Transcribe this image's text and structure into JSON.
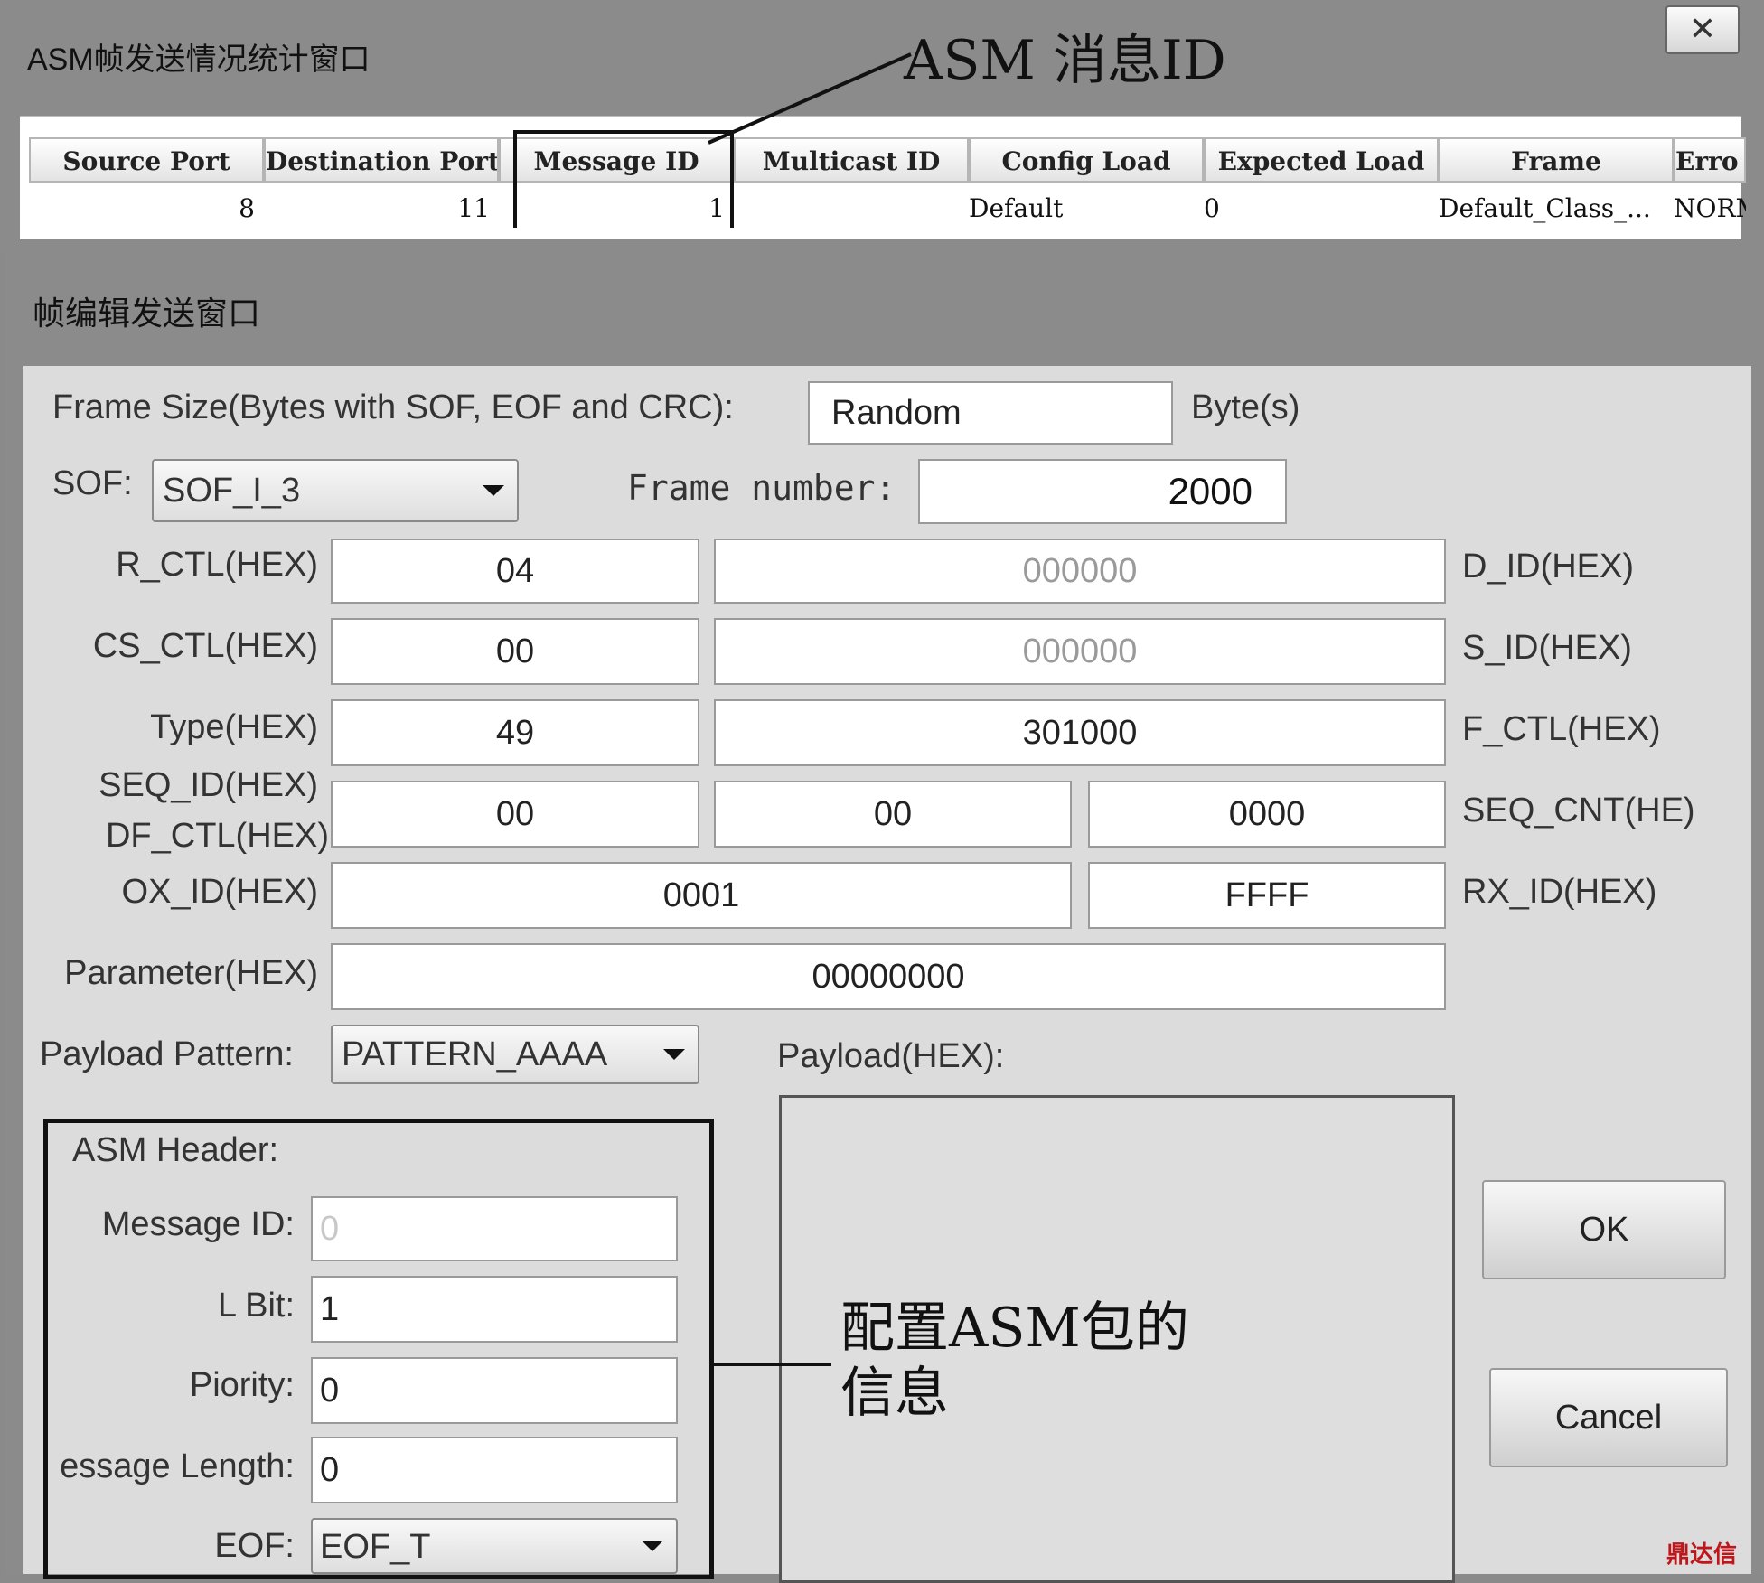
{
  "stats_window": {
    "title": "ASM帧发送情况统计窗口",
    "close": "✕",
    "columns": [
      "Source Port",
      "Destination Port",
      "Message ID",
      "Multicast ID",
      "Config Load",
      "Expected Load",
      "Frame",
      "Erro"
    ],
    "row": [
      "8",
      "11",
      "1",
      "",
      "Default",
      "0",
      "Default_Class_...",
      "NORMA"
    ]
  },
  "annotations": {
    "asm_msg_id": "ASM 消息ID",
    "config_asm_line1": "配置ASM包的",
    "config_asm_line2": "信息"
  },
  "edit_window": {
    "title": "帧编辑发送窗口",
    "frame_size_label": "Frame Size(Bytes with SOF, EOF and CRC):",
    "frame_size_value": "Random",
    "frame_size_unit": "Byte(s)",
    "sof_label": "SOF:",
    "sof_value": "SOF_I_3",
    "frame_number_label": "Frame number:",
    "frame_number_value": "2000",
    "r_ctl_label": "R_CTL(HEX)",
    "r_ctl_value": "04",
    "d_id_label": "D_ID(HEX)",
    "d_id_value": "000000",
    "cs_ctl_label": "CS_CTL(HEX)",
    "cs_ctl_value": "00",
    "s_id_label": "S_ID(HEX)",
    "s_id_value": "000000",
    "type_label": "Type(HEX)",
    "type_value": "49",
    "f_ctl_label": "F_CTL(HEX)",
    "f_ctl_value": "301000",
    "seq_id_label": "SEQ_ID(HEX)",
    "df_ctl_label": "DF_CTL(HEX)",
    "seq_id_value": "00",
    "df_ctl_value": "00",
    "seq_cnt_value": "0000",
    "seq_cnt_label": "SEQ_CNT(HE)",
    "ox_id_label": "OX_ID(HEX)",
    "ox_id_value": "0001",
    "rx_id_value": "FFFF",
    "rx_id_label": "RX_ID(HEX)",
    "parameter_label": "Parameter(HEX)",
    "parameter_value": "00000000",
    "payload_pattern_label": "Payload Pattern:",
    "payload_pattern_value": "PATTERN_AAAA",
    "payload_hex_label": "Payload(HEX):",
    "asm_header": {
      "title": "ASM Header:",
      "message_id_label": "Message ID:",
      "message_id_placeholder": "0",
      "l_bit_label": "L Bit:",
      "l_bit_value": "1",
      "piority_label": "Piority:",
      "piority_value": "0",
      "message_length_label": "essage Length:",
      "message_length_value": "0",
      "eof_label": "EOF:",
      "eof_value": "EOF_T"
    },
    "ok": "OK",
    "cancel": "Cancel"
  },
  "watermark": "鼎达信"
}
